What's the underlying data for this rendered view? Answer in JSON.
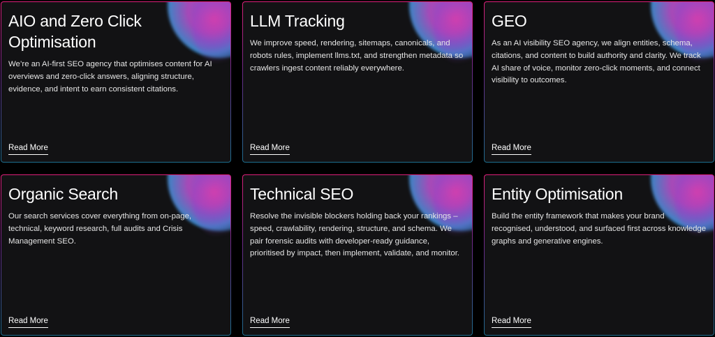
{
  "cards": [
    {
      "title": "AIO and Zero Click Optimisation",
      "body": "We’re an AI-first SEO agency that optimises content for AI overviews and zero-click answers, aligning structure, evidence, and intent to earn consistent citations.",
      "link": "Read More"
    },
    {
      "title": "LLM Tracking",
      "body": "We improve speed, rendering, sitemaps, canonicals, and robots rules, implement llms.txt, and strengthen metadata so crawlers ingest content reliably everywhere.",
      "link": "Read More"
    },
    {
      "title": "GEO",
      "body": "As an AI visibility SEO agency, we align entities, schema, citations, and content to build authority and clarity. We track AI share of voice, monitor zero-click moments, and connect visibility to outcomes.",
      "link": "Read More"
    },
    {
      "title": "Organic Search",
      "body": "Our search services cover everything from on-page, technical, keyword research, full audits and Crisis Management SEO.",
      "link": "Read More"
    },
    {
      "title": "Technical SEO",
      "body": "Resolve the invisible blockers holding back your rankings – speed, crawlability, rendering, structure, and schema. We pair forensic audits with developer-ready guidance, prioritised by impact, then implement, validate, and monitor.",
      "link": "Read More"
    },
    {
      "title": "Entity Optimisation",
      "body": "Build the entity framework that makes your brand recognised, understood, and surfaced first across knowledge graphs and generative engines.",
      "link": "Read More"
    }
  ]
}
